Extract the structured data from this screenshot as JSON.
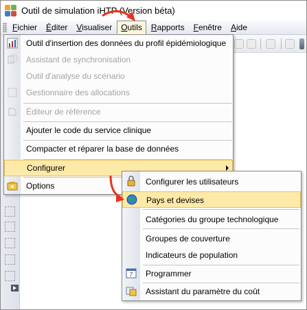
{
  "window": {
    "title": "Outil de simulation iHTP (Version béta)"
  },
  "menubar": {
    "items": [
      "Fichier",
      "Éditer",
      "Visualiser",
      "Outils",
      "Rapports",
      "Fenêtre",
      "Aide"
    ],
    "active": "Outils"
  },
  "outils_menu": {
    "items": [
      {
        "label": "Outil d'insertion des données du profil épidémiologique",
        "enabled": true,
        "icon": "chart-icon"
      },
      {
        "label": "Assistant de synchronisation",
        "enabled": false,
        "icon": "sync-icon"
      },
      {
        "label": "Outil d'analyse du scénario",
        "enabled": false,
        "icon": ""
      },
      {
        "label": "Gestionnaire des allocations",
        "enabled": false,
        "icon": "allocation-icon"
      },
      {
        "label": "Éditeur de référence",
        "enabled": false,
        "icon": "reference-icon"
      },
      {
        "label": "Ajouter le code du service clinique",
        "enabled": true,
        "icon": ""
      },
      {
        "label": "Compacter et réparer la base de données",
        "enabled": true,
        "icon": ""
      },
      {
        "label": "Configurer",
        "enabled": true,
        "icon": "",
        "submenu": true,
        "highlighted": true
      },
      {
        "label": "Options",
        "enabled": true,
        "icon": "options-icon"
      }
    ]
  },
  "configurer_submenu": {
    "items": [
      {
        "label": "Configurer les utilisateurs",
        "icon": "users-lock-icon"
      },
      {
        "label": "Pays et devises",
        "icon": "globe-icon",
        "highlighted": true
      },
      {
        "label": "Catégories du groupe technologique",
        "icon": ""
      },
      {
        "label": "Groupes de couverture",
        "icon": ""
      },
      {
        "label": "Indicateurs de population",
        "icon": ""
      },
      {
        "label": "Programmer",
        "icon": "calendar-icon"
      },
      {
        "label": "Assistant du paramètre du coût",
        "icon": "cost-wizard-icon"
      }
    ]
  },
  "colors": {
    "highlight": "#fde9a8",
    "arrow": "#e8321e",
    "disabled_text": "#a3a3a3"
  }
}
